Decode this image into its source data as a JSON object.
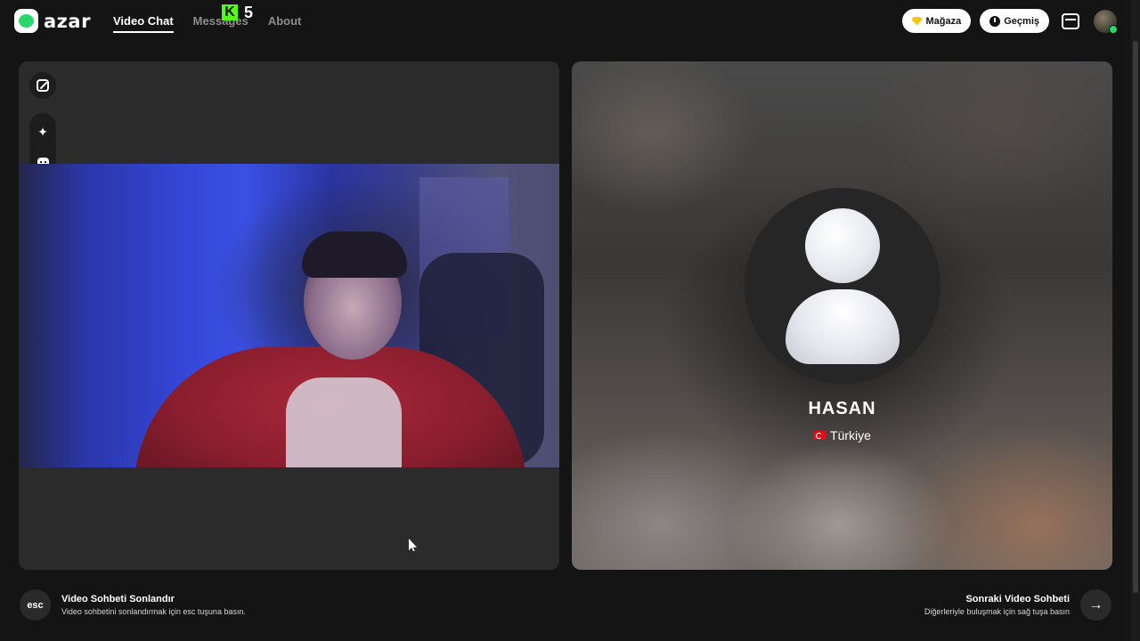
{
  "header": {
    "logo_text": "azar",
    "nav": [
      {
        "label": "Video Chat",
        "active": true
      },
      {
        "label": "Messages",
        "active": false
      },
      {
        "label": "About",
        "active": false
      }
    ],
    "overlay_badge": "K",
    "overlay_number": "5",
    "shop_label": "Mağaza",
    "history_label": "Geçmiş"
  },
  "tools": {
    "expand_icon": "expand-icon",
    "magic_icon": "magic-wand-icon",
    "face_icon": "face-sticker-icon"
  },
  "partner": {
    "name": "HASAN",
    "country": "Türkiye",
    "flag": "turkey-flag-icon"
  },
  "footer": {
    "esc_key": "esc",
    "end_title": "Video Sohbeti Sonlandır",
    "end_sub": "Video sohbetini sonlandırmak için esc tuşuna basın.",
    "next_title": "Sonraki Video Sohbeti",
    "next_sub": "Diğerleriyle buluşmak için sağ tuşa basın"
  },
  "colors": {
    "background": "#141414",
    "panel": "#2b2b2b",
    "brand_green": "#27d86b"
  }
}
